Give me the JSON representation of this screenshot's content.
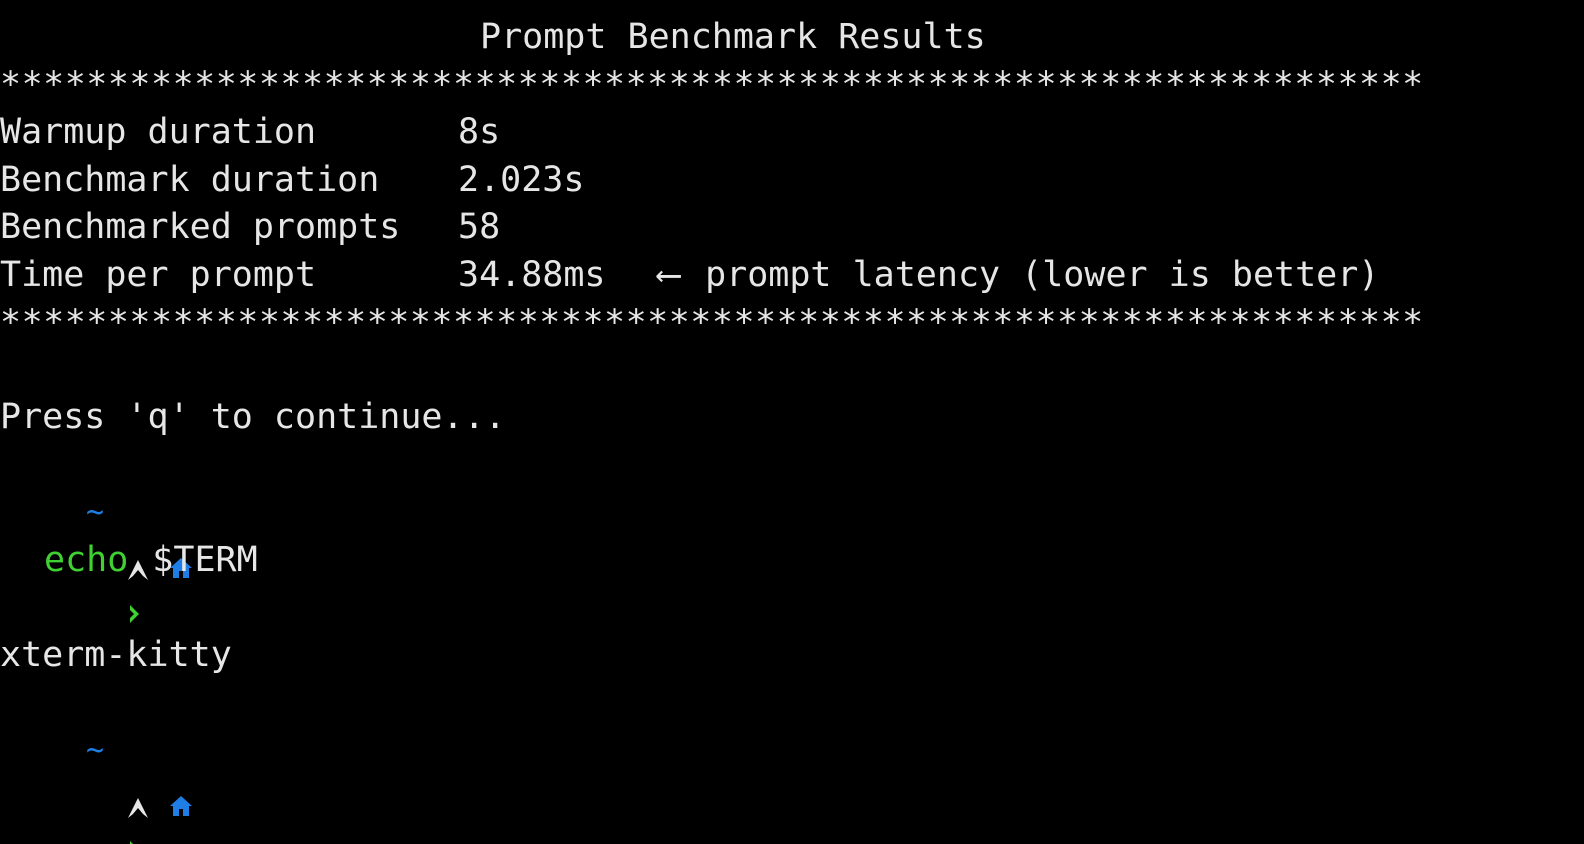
{
  "terminal": {
    "title": "Prompt Benchmark Results",
    "separator": "******************************************************************",
    "rows": [
      {
        "label": "Warmup duration",
        "value": "8s",
        "note": ""
      },
      {
        "label": "Benchmark duration",
        "value": "2.023s",
        "note": ""
      },
      {
        "label": "Benchmarked prompts",
        "value": "58",
        "note": ""
      },
      {
        "label": "Time per prompt",
        "value": "34.88ms",
        "arrow": "⟵",
        "note": "prompt latency (lower is better)"
      }
    ],
    "press_message": "Press 'q' to continue...",
    "prompt1": {
      "dir": "~",
      "command": "echo",
      "argument": "$TERM"
    },
    "output": "xterm-kitty",
    "prompt2": {
      "dir": "~"
    }
  },
  "colors": {
    "background": "#000000",
    "text": "#e6e6e6",
    "command_green": "#3fd032",
    "dir_blue": "#1e7ee6"
  },
  "icons": {
    "os": "arch-linux-icon",
    "home": "home-icon",
    "prompt": "chevron-right-icon"
  }
}
